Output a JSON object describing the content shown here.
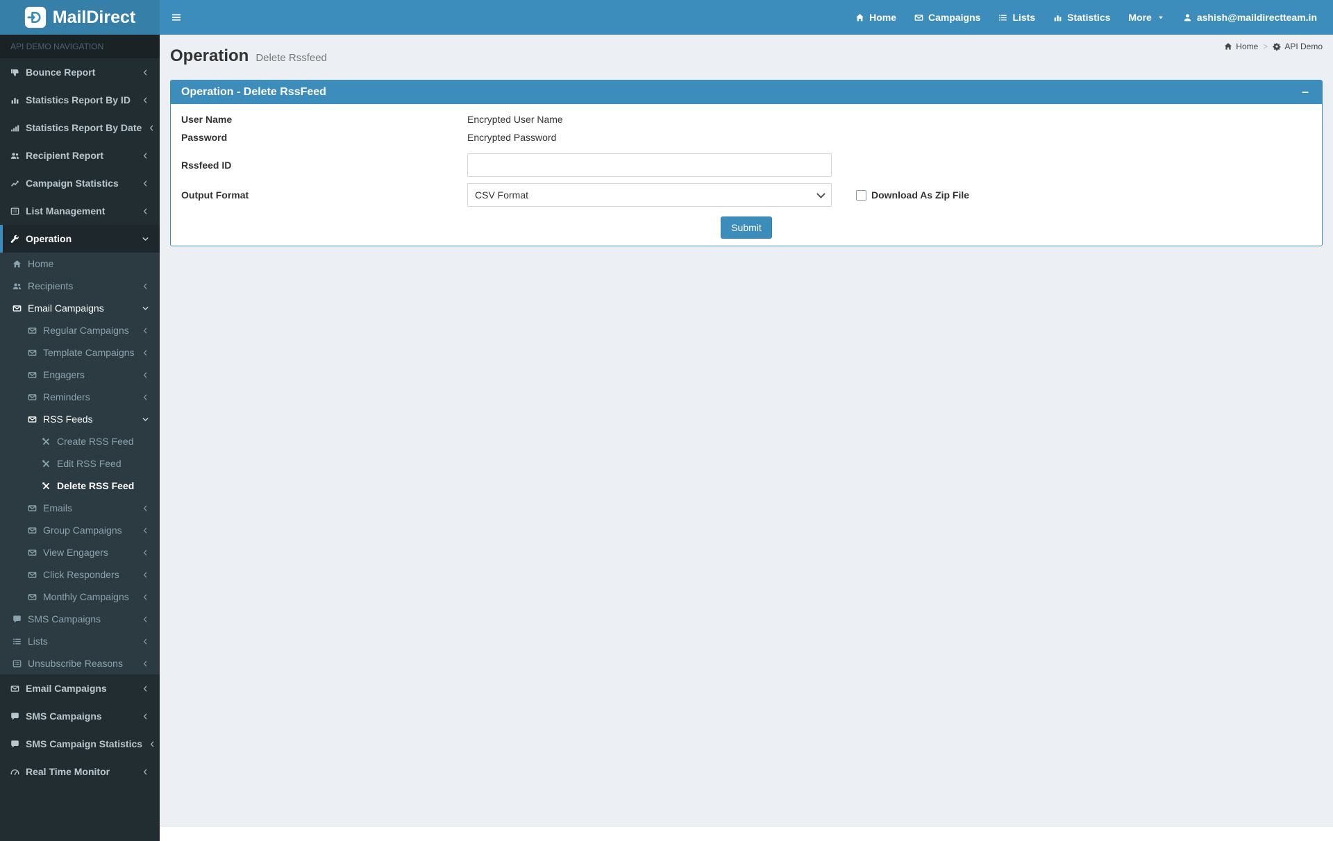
{
  "header": {
    "brand": "MailDirect",
    "nav": [
      {
        "label": "Home",
        "icon": "home"
      },
      {
        "label": "Campaigns",
        "icon": "envelope"
      },
      {
        "label": "Lists",
        "icon": "list"
      },
      {
        "label": "Statistics",
        "icon": "bar-chart"
      },
      {
        "label": "More",
        "caret": true
      },
      {
        "label": "ashish@maildirectteam.in",
        "icon": "user"
      }
    ]
  },
  "sidebar": {
    "header": "API DEMO NAVIGATION",
    "items": [
      {
        "label": "Bounce Report",
        "icon": "thumbs-down",
        "depth": 0,
        "arrow": "left"
      },
      {
        "label": "Statistics Report By ID",
        "icon": "bar-chart",
        "depth": 0,
        "arrow": "left"
      },
      {
        "label": "Statistics Report By Date",
        "icon": "signal",
        "depth": 0,
        "arrow": "left"
      },
      {
        "label": "Recipient Report",
        "icon": "users",
        "depth": 0,
        "arrow": "left"
      },
      {
        "label": "Campaign Statistics",
        "icon": "line-chart",
        "depth": 0,
        "arrow": "left"
      },
      {
        "label": "List Management",
        "icon": "list-alt",
        "depth": 0,
        "arrow": "left"
      },
      {
        "label": "Operation",
        "icon": "wrench",
        "depth": 0,
        "arrow": "down",
        "active": true
      },
      {
        "label": "Home",
        "icon": "home",
        "depth": 1,
        "sub": true
      },
      {
        "label": "Recipients",
        "icon": "users",
        "depth": 1,
        "sub": true,
        "arrow": "left"
      },
      {
        "label": "Email Campaigns",
        "icon": "envelope",
        "depth": 1,
        "sub": true,
        "arrow": "down",
        "open": true
      },
      {
        "label": "Regular Campaigns",
        "icon": "envelope",
        "depth": 2,
        "sub": true,
        "arrow": "left"
      },
      {
        "label": "Template Campaigns",
        "icon": "envelope",
        "depth": 2,
        "sub": true,
        "arrow": "left"
      },
      {
        "label": "Engagers",
        "icon": "envelope",
        "depth": 2,
        "sub": true,
        "arrow": "left"
      },
      {
        "label": "Reminders",
        "icon": "envelope",
        "depth": 2,
        "sub": true,
        "arrow": "left"
      },
      {
        "label": "RSS Feeds",
        "icon": "envelope",
        "depth": 2,
        "sub": true,
        "arrow": "down",
        "open": true
      },
      {
        "label": "Create RSS Feed",
        "icon": "tools",
        "depth": 3,
        "sub": true
      },
      {
        "label": "Edit RSS Feed",
        "icon": "tools",
        "depth": 3,
        "sub": true
      },
      {
        "label": "Delete RSS Feed",
        "icon": "tools",
        "depth": 3,
        "sub": true,
        "active": true
      },
      {
        "label": "Emails",
        "icon": "envelope",
        "depth": 2,
        "sub": true,
        "arrow": "left"
      },
      {
        "label": "Group Campaigns",
        "icon": "envelope",
        "depth": 2,
        "sub": true,
        "arrow": "left"
      },
      {
        "label": "View Engagers",
        "icon": "envelope",
        "depth": 2,
        "sub": true,
        "arrow": "left"
      },
      {
        "label": "Click Responders",
        "icon": "envelope",
        "depth": 2,
        "sub": true,
        "arrow": "left"
      },
      {
        "label": "Monthly Campaigns",
        "icon": "envelope",
        "depth": 2,
        "sub": true,
        "arrow": "left"
      },
      {
        "label": "SMS Campaigns",
        "icon": "comment",
        "depth": 1,
        "sub": true,
        "arrow": "left"
      },
      {
        "label": "Lists",
        "icon": "list",
        "depth": 1,
        "sub": true,
        "arrow": "left"
      },
      {
        "label": "Unsubscribe Reasons",
        "icon": "list-alt",
        "depth": 1,
        "sub": true,
        "arrow": "left"
      },
      {
        "label": "Email Campaigns",
        "icon": "envelope",
        "depth": 0,
        "arrow": "left"
      },
      {
        "label": "SMS Campaigns",
        "icon": "comment",
        "depth": 0,
        "arrow": "left"
      },
      {
        "label": "SMS Campaign Statistics",
        "icon": "comment",
        "depth": 0,
        "arrow": "left"
      },
      {
        "label": "Real Time Monitor",
        "icon": "gauge",
        "depth": 0,
        "arrow": "left"
      }
    ]
  },
  "page": {
    "title": "Operation",
    "subtitle": "Delete Rssfeed",
    "breadcrumb_separator": ">",
    "breadcrumb": [
      {
        "label": "Home",
        "icon": "home"
      },
      {
        "label": "API Demo",
        "icon": "cog"
      }
    ]
  },
  "panel": {
    "title": "Operation - Delete RssFeed",
    "collapse_icon": "minus"
  },
  "form": {
    "rows": [
      {
        "label": "User Name",
        "type": "static",
        "value": "Encrypted User Name"
      },
      {
        "label": "Password",
        "type": "static",
        "value": "Encrypted Password"
      },
      {
        "label": "Rssfeed ID",
        "type": "input",
        "value": ""
      },
      {
        "label": "Output Format",
        "type": "select",
        "value": "CSV Format",
        "checkbox": {
          "label": "Download As Zip File",
          "checked": false
        }
      }
    ],
    "submit_label": "Submit"
  },
  "colors": {
    "accent": "#3c8dbc",
    "logo_bg": "#367fa9",
    "sidebar_bg": "#222d32",
    "submenu_bg": "#2c3b41",
    "sidebar_header_bg": "#1a2226",
    "content_bg": "#ecf0f5"
  }
}
